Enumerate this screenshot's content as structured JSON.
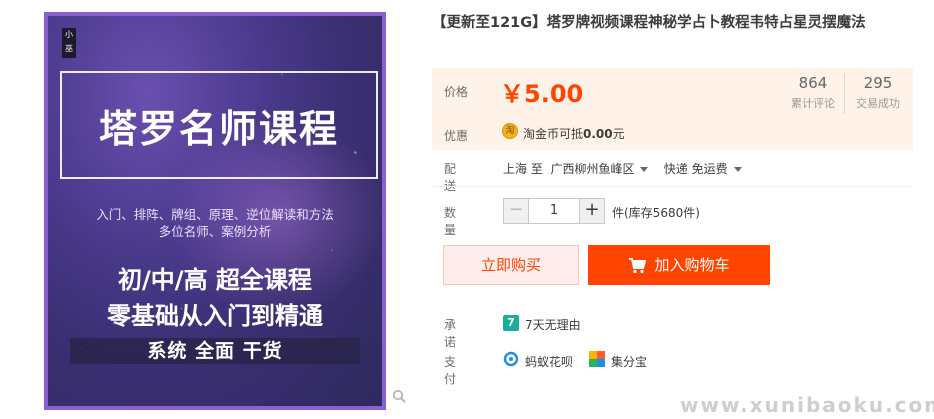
{
  "product_image": {
    "seal_text": "小巫",
    "main_title": "塔罗名师课程",
    "subtitle_line1": "入门、排阵、牌组、原理、逆位解读和方法",
    "subtitle_line2": "多位名师、案例分析",
    "headline1": "初/中/高 超全课程",
    "headline2": "零基础从入门到精通",
    "tagline": "系统  全面  干货"
  },
  "product": {
    "title": "【更新至121G】塔罗牌视频课程神秘学占卜教程韦特占星灵摆魔法"
  },
  "price_panel": {
    "price_label": "价格",
    "price": "￥5.00",
    "reviews_count": "864",
    "reviews_label": "累计评论",
    "sales_count": "295",
    "sales_label": "交易成功",
    "promo_label": "优惠",
    "coin_icon_text": "淘",
    "promo_text_prefix": "淘金币可抵",
    "promo_amount": "0.00",
    "promo_text_suffix": "元"
  },
  "shipping": {
    "label": "配送",
    "from": "上海 至",
    "to": "广西柳州鱼峰区",
    "method": "快递 免运费"
  },
  "quantity": {
    "label": "数量",
    "minus": "−",
    "value": "1",
    "plus": "+",
    "stock": "件(库存5680件)"
  },
  "actions": {
    "buy_now": "立即购买",
    "add_to_cart": "加入购物车"
  },
  "promise": {
    "label": "承诺",
    "icon_text": "7",
    "text": "7天无理由"
  },
  "payment": {
    "label": "支付",
    "methods": [
      "蚂蚁花呗",
      "集分宝"
    ]
  },
  "watermark": "www.xunibaoku.com",
  "colors": {
    "accent": "#ff4400",
    "panel_bg": "#fff2e8",
    "image_border": "#8a5fd4"
  },
  "icons": [
    "zoom-icon",
    "coin-icon",
    "cart-icon",
    "caret-down-icon",
    "seven-day-icon",
    "huabei-icon",
    "jifenbao-icon"
  ]
}
